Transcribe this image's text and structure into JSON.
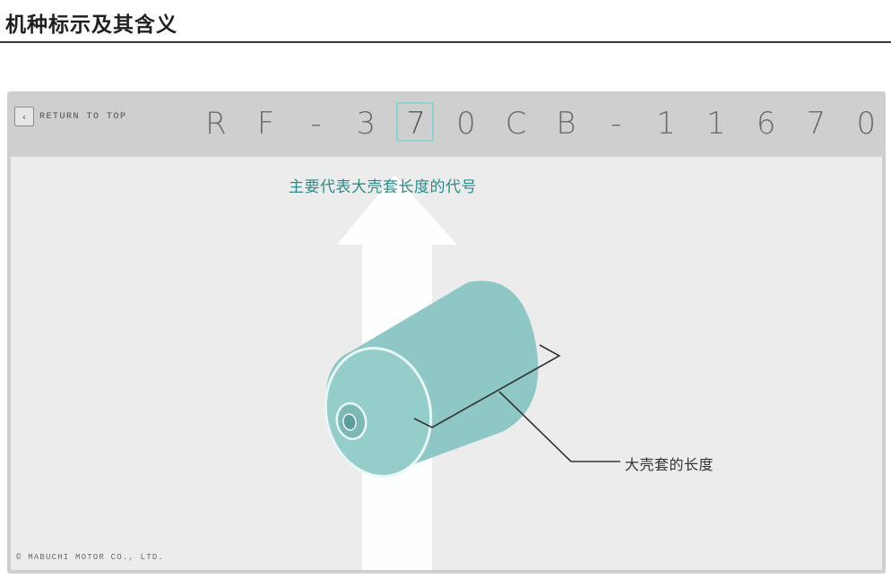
{
  "page": {
    "title": "机种标示及其含义"
  },
  "viewer": {
    "return_label": "RETURN TO TOP",
    "return_icon": "chevron-left-icon",
    "model_code": [
      "R",
      "F",
      "-",
      "3",
      "7",
      "0",
      "C",
      "B",
      "-",
      "1",
      "1",
      "6",
      "7",
      "0"
    ],
    "selected_index": 4,
    "selected_char": "7",
    "accent_color": "#8fd0d0",
    "annotation_top": "主要代表大壳套长度的代号",
    "annotation_side": "大壳套的长度",
    "copyright": "© MABUCHI MOTOR CO., LTD."
  }
}
